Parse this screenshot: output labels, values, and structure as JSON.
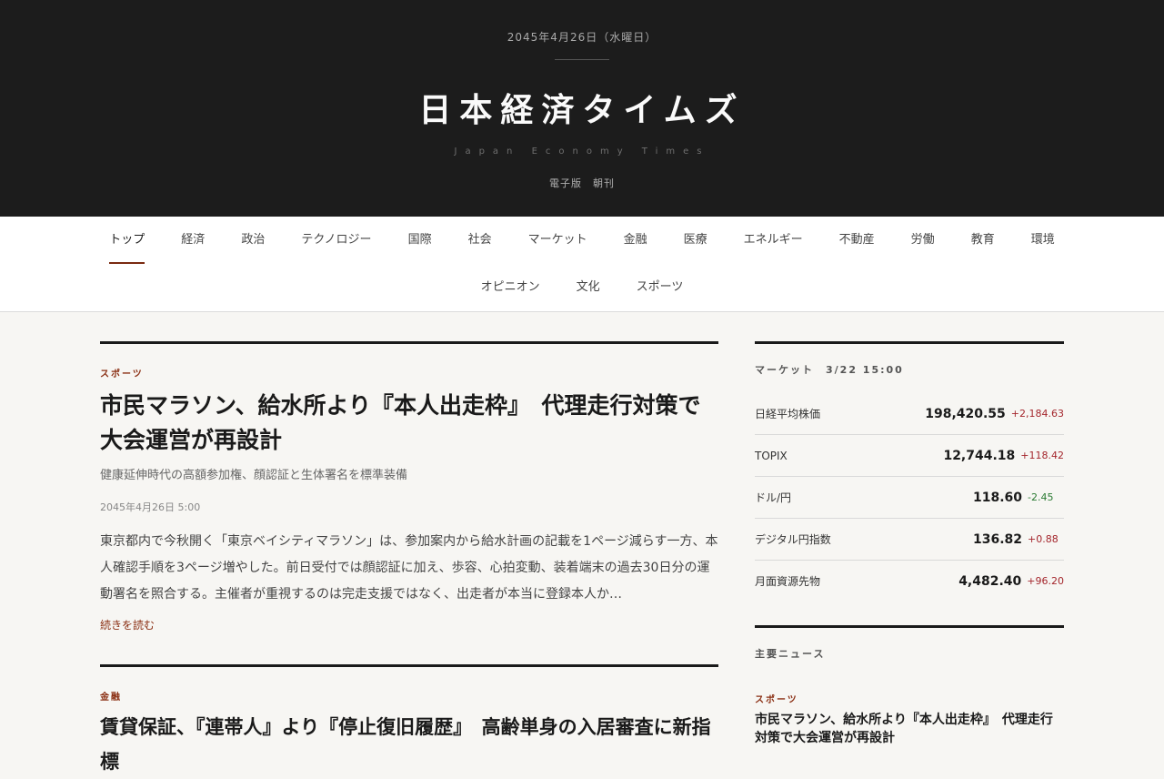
{
  "masthead": {
    "date": "2045年4月26日（水曜日）",
    "title": "日本経済タイムズ",
    "subtitle": "Japan Economy Times",
    "edition": "電子版　朝刊"
  },
  "nav": {
    "row1": [
      {
        "label": "トップ",
        "active": true
      },
      {
        "label": "経済"
      },
      {
        "label": "政治"
      },
      {
        "label": "テクノロジー"
      },
      {
        "label": "国際"
      },
      {
        "label": "社会"
      },
      {
        "label": "マーケット"
      },
      {
        "label": "金融"
      },
      {
        "label": "医療"
      },
      {
        "label": "エネルギー"
      },
      {
        "label": "不動産"
      },
      {
        "label": "労働"
      },
      {
        "label": "教育"
      },
      {
        "label": "環境"
      }
    ],
    "row2": [
      {
        "label": "オピニオン"
      },
      {
        "label": "文化"
      },
      {
        "label": "スポーツ"
      }
    ]
  },
  "articles": [
    {
      "category": "スポーツ",
      "headline": "市民マラソン、給水所より『本人出走枠』　代理走行対策で大会運営が再設計",
      "deck": "健康延伸時代の高額参加権、顔認証と生体署名を標準装備",
      "timestamp": "2045年4月26日 5:00",
      "body": "東京都内で今秋開く「東京ベイシティマラソン」は、参加案内から給水計画の記載を1ページ減らす一方、本人確認手順を3ページ増やした。前日受付では顔認証に加え、歩容、心拍変動、装着端末の過去30日分の運動署名を照合する。主催者が重視するのは完走支援ではなく、出走者が本当に登録本人か…",
      "read_more": "続きを読む"
    },
    {
      "category": "金融",
      "headline": "賃貸保証、『連帯人』より『停止復旧履歴』　高齢単身の入居審査に新指標"
    }
  ],
  "market": {
    "title": "マーケット　3/22 15:00",
    "rows": [
      {
        "name": "日経平均株価",
        "value": "198,420.55",
        "change": "+2,184.63",
        "direction": "up"
      },
      {
        "name": "TOPIX",
        "value": "12,744.18",
        "change": "+118.42",
        "direction": "up"
      },
      {
        "name": "ドル/円",
        "value": "118.60",
        "change": "-2.45",
        "direction": "down"
      },
      {
        "name": "デジタル円指数",
        "value": "136.82",
        "change": "+0.88",
        "direction": "up"
      },
      {
        "name": "月面資源先物",
        "value": "4,482.40",
        "change": "+96.20",
        "direction": "up"
      }
    ]
  },
  "top_news": {
    "title": "主要ニュース",
    "items": [
      {
        "category": "スポーツ",
        "title": "市民マラソン、給水所より『本人出走枠』　代理走行対策で大会運営が再設計"
      }
    ]
  },
  "colors": {
    "masthead_bg": "#1c1c1c",
    "accent": "#8a2e12",
    "up": "#a4262c",
    "down": "#2a7a32",
    "page_bg": "#f7f6f3"
  }
}
